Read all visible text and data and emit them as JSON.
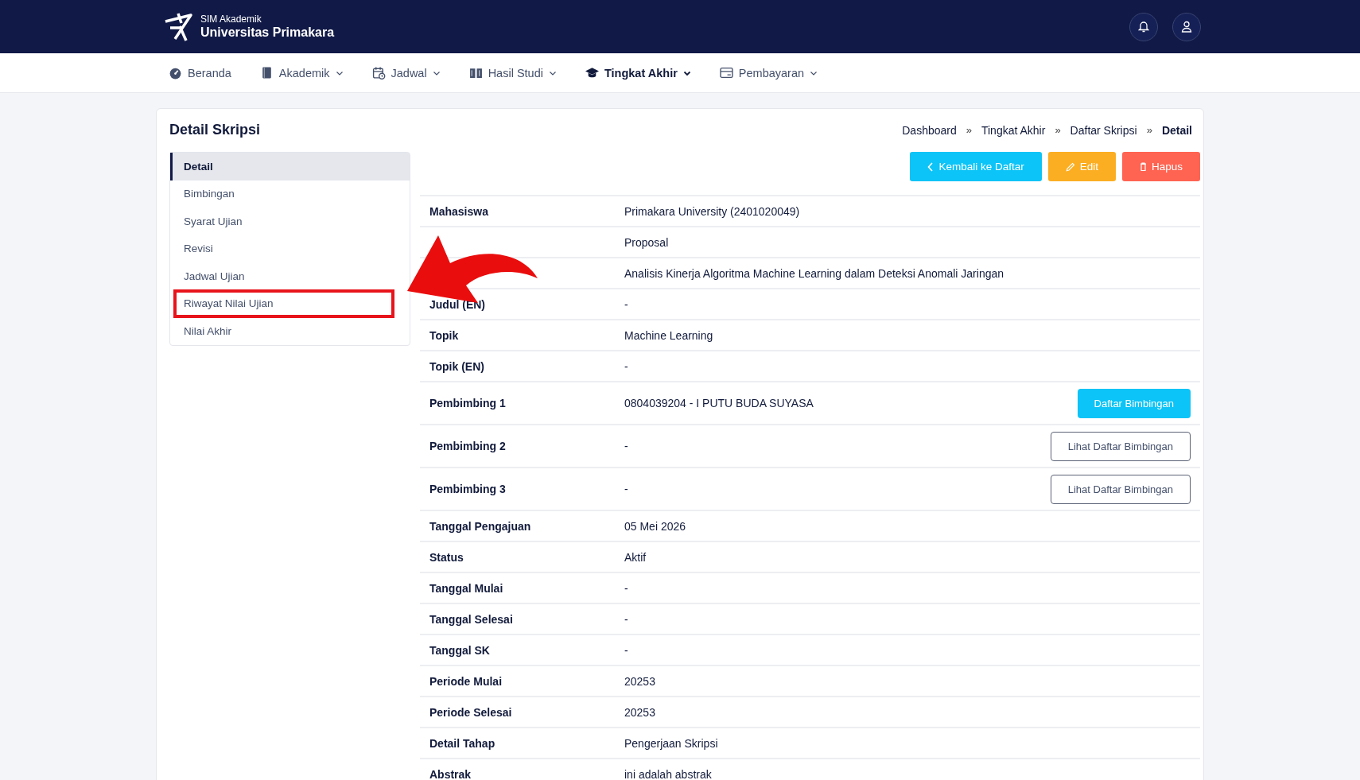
{
  "header": {
    "subtitle": "SIM Akademik",
    "title": "Universitas Primakara"
  },
  "nav": [
    {
      "label": "Beranda",
      "dropdown": false,
      "selected": false
    },
    {
      "label": "Akademik",
      "dropdown": true,
      "selected": false
    },
    {
      "label": "Jadwal",
      "dropdown": true,
      "selected": false
    },
    {
      "label": "Hasil Studi",
      "dropdown": true,
      "selected": false
    },
    {
      "label": "Tingkat Akhir",
      "dropdown": true,
      "selected": true
    },
    {
      "label": "Pembayaran",
      "dropdown": true,
      "selected": false
    }
  ],
  "page_title": "Detail Skripsi",
  "breadcrumb": [
    {
      "text": "Dashboard",
      "kind": "link"
    },
    {
      "text": "»",
      "kind": "separator"
    },
    {
      "text": "Tingkat Akhir",
      "kind": "link"
    },
    {
      "text": "»",
      "kind": "separator"
    },
    {
      "text": "Daftar Skripsi",
      "kind": "link"
    },
    {
      "text": "»",
      "kind": "separator"
    },
    {
      "text": "Detail",
      "kind": "current"
    }
  ],
  "sidebar": {
    "items": [
      {
        "label": "Detail",
        "selected": true,
        "highlighted": false
      },
      {
        "label": "Bimbingan",
        "selected": false,
        "highlighted": false
      },
      {
        "label": "Syarat Ujian",
        "selected": false,
        "highlighted": false
      },
      {
        "label": "Revisi",
        "selected": false,
        "highlighted": false
      },
      {
        "label": "Jadwal Ujian",
        "selected": false,
        "highlighted": false
      },
      {
        "label": "Riwayat Nilai Ujian",
        "selected": false,
        "highlighted": true
      },
      {
        "label": "Nilai Akhir",
        "selected": false,
        "highlighted": false
      }
    ]
  },
  "actions": [
    {
      "label": "Kembali ke Daftar",
      "kind": "back"
    },
    {
      "label": "Edit",
      "kind": "edit"
    },
    {
      "label": "Hapus",
      "kind": "delete"
    }
  ],
  "details": [
    {
      "label": "Mahasiswa",
      "value": "Primakara University (2401020049)"
    },
    {
      "value": "Proposal"
    },
    {
      "value": "Analisis Kinerja Algoritma Machine Learning dalam Deteksi Anomali Jaringan"
    },
    {
      "label": "Judul (EN)",
      "value": "-"
    },
    {
      "label": "Topik",
      "value": "Machine Learning"
    },
    {
      "label": "Topik (EN)",
      "value": "-"
    },
    {
      "label": "Pembimbing 1",
      "value": "0804039204 - I PUTU BUDA SUYASA",
      "button": {
        "label": "Daftar Bimbingan",
        "kind": "primary"
      }
    },
    {
      "label": "Pembimbing 2",
      "value": "-",
      "button": {
        "label": "Lihat Daftar Bimbingan",
        "kind": "outline"
      }
    },
    {
      "label": "Pembimbing 3",
      "value": "-",
      "button": {
        "label": "Lihat Daftar Bimbingan",
        "kind": "outline"
      }
    },
    {
      "label": "Tanggal Pengajuan",
      "value": "05 Mei 2026"
    },
    {
      "label": "Status",
      "value": "Aktif"
    },
    {
      "label": "Tanggal Mulai",
      "value": "-"
    },
    {
      "label": "Tanggal Selesai",
      "value": "-"
    },
    {
      "label": "Tanggal SK",
      "value": "-"
    },
    {
      "label": "Periode Mulai",
      "value": "20253"
    },
    {
      "label": "Periode Selesai",
      "value": "20253"
    },
    {
      "label": "Detail Tahap",
      "value": "Pengerjaan Skripsi"
    },
    {
      "label": "Abstrak",
      "value": "ini adalah abstrak"
    }
  ]
}
